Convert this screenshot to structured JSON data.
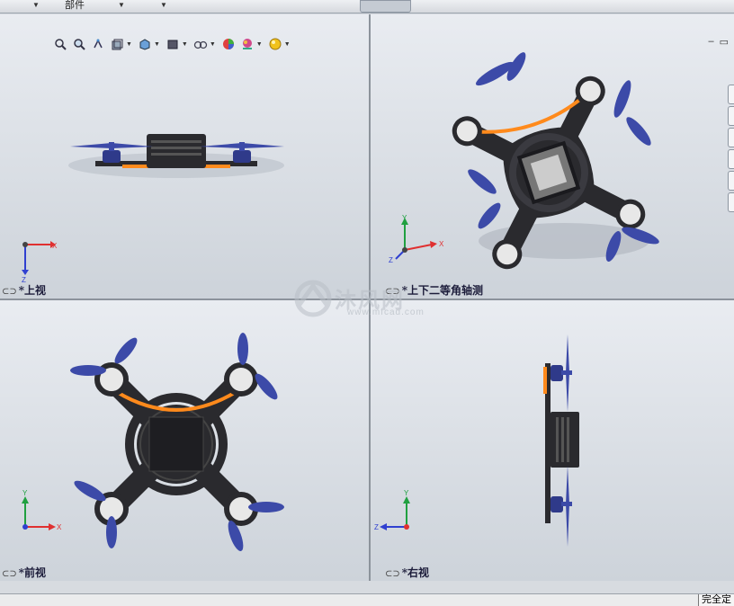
{
  "toolbar": {
    "tabs": [
      {
        "label": "",
        "has_dropdown": true
      },
      {
        "label": "部件",
        "has_dropdown": true
      },
      {
        "label": "",
        "has_dropdown": true
      }
    ]
  },
  "hud": {
    "buttons": [
      {
        "icon": "zoom-to-fit-icon"
      },
      {
        "icon": "zoom-to-area-icon"
      },
      {
        "icon": "previous-view-icon"
      },
      {
        "icon": "section-view-icon"
      },
      {
        "icon": "view-orientation-icon",
        "has_dropdown": true
      },
      {
        "icon": "display-style-icon",
        "has_dropdown": true
      },
      {
        "icon": "hide-show-items-icon",
        "has_dropdown": true
      },
      {
        "icon": "edit-appearance-icon"
      },
      {
        "icon": "apply-scene-icon",
        "has_dropdown": true
      },
      {
        "icon": "view-settings-icon",
        "has_dropdown": true
      }
    ]
  },
  "window_controls": {
    "minimize": "–",
    "restore": "▭"
  },
  "viewports": {
    "top_left": {
      "label": "*上视",
      "triad": {
        "axis1": "X",
        "axis2": "Z"
      }
    },
    "top_right": {
      "label": "*上下二等角轴测",
      "triad": {
        "axis1": "Y",
        "axis2": "X",
        "axis3": "Z"
      }
    },
    "bottom_left": {
      "label": "*前视",
      "triad": {
        "axis1": "Y",
        "axis2": "X"
      }
    },
    "bottom_right": {
      "label": "*右视",
      "triad": {
        "axis1": "Y",
        "axis2": "Z"
      }
    }
  },
  "watermark": {
    "text": "沐风网",
    "url": "www.mfcad.com"
  },
  "status_bar": {
    "text": "完全定"
  },
  "colors": {
    "frame": "#2a2a2e",
    "motor": "#2f3a8a",
    "propeller": "#3c4aa8",
    "battery_strap": "#ff8a1c",
    "axis_x": "#e03030",
    "axis_y": "#20a040",
    "axis_z": "#3040d0"
  }
}
